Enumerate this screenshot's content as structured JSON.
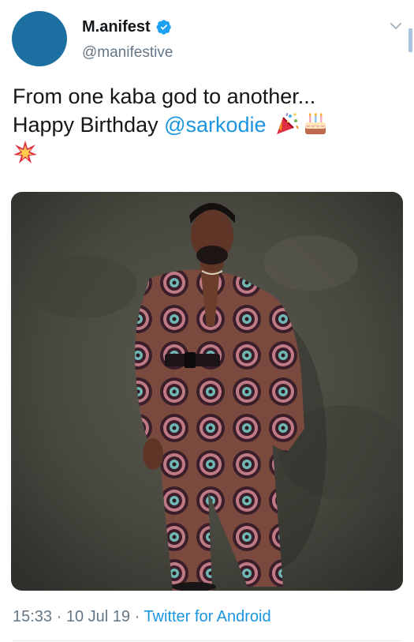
{
  "author": {
    "display_name": "M.anifest",
    "handle": "@manifestive",
    "verified_icon": "verified-badge-icon",
    "avatar_color": "#1b6fa1"
  },
  "tweet": {
    "line1": "From one kaba god to another...",
    "line2_prefix": "Happy Birthday ",
    "mention": "@sarkodie",
    "emojis": [
      "party-popper-icon",
      "birthday-cake-icon",
      "sparkle-burst-icon"
    ]
  },
  "photo": {
    "description_icon": "photo-image-icon"
  },
  "meta": {
    "time": "15:33",
    "separator1": " · ",
    "date": "10 Jul 19",
    "separator2": " · ",
    "source": "Twitter for Android"
  },
  "colors": {
    "link": "#1b95e0",
    "secondary_text": "#657786",
    "primary_text": "#14171a"
  }
}
